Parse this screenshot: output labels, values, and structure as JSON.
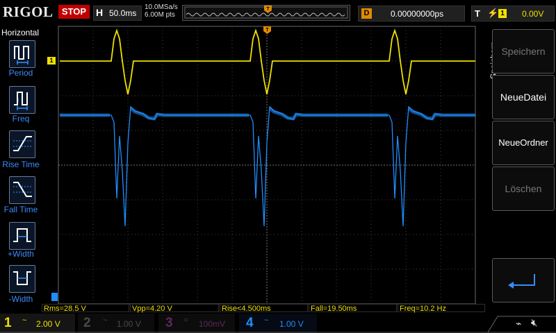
{
  "brand": "RIGOL",
  "run_state": "STOP",
  "horizontal": {
    "letter": "H",
    "timebase": "50.0ms",
    "sample_rate": "10.0MSa/s",
    "memory_depth": "6.00M pts"
  },
  "delay": {
    "letter": "D",
    "value": "0.00000000ps"
  },
  "trigger": {
    "letter": "T",
    "edge_icon": "rising-edge-icon",
    "source": "1",
    "level": "0.00V"
  },
  "left_menu": {
    "title": "Horizontal",
    "items": [
      {
        "label": "Period",
        "icon": "period-icon"
      },
      {
        "label": "Freq",
        "icon": "freq-icon"
      },
      {
        "label": "Rise Time",
        "icon": "rise-time-icon"
      },
      {
        "label": "Fall Time",
        "icon": "fall-time-icon"
      },
      {
        "label": "+Width",
        "icon": "plus-width-icon"
      },
      {
        "label": "-Width",
        "icon": "minus-width-icon"
      }
    ]
  },
  "right_menu": {
    "title": "Speichern",
    "items": [
      {
        "label": "Speichern",
        "enabled": false
      },
      {
        "label": "NeueDatei",
        "enabled": true
      },
      {
        "label": "NeueOrdner",
        "enabled": true
      },
      {
        "label": "Löschen",
        "enabled": false
      },
      {
        "label": "",
        "icon": "enter-arrow-icon",
        "enabled": true
      }
    ]
  },
  "ch1_marker": "1",
  "measurements": [
    {
      "label": "Rms=28.5 V"
    },
    {
      "label": "Vpp=4.20 V"
    },
    {
      "label": "Rise<4.500ms"
    },
    {
      "label": "Fall=19.50ms"
    },
    {
      "label": "Freq=10.2 Hz"
    }
  ],
  "channels": [
    {
      "num": "1",
      "coupling": "~",
      "scale": "2.00 V",
      "color": "#f0e000",
      "active": true
    },
    {
      "num": "2",
      "coupling": "~",
      "scale": "1.00 V",
      "color": "#4a4a4a",
      "active": false
    },
    {
      "num": "3",
      "coupling": "=",
      "scale": "100mV",
      "color": "#5a2a5a",
      "active": false
    },
    {
      "num": "4",
      "coupling": "~",
      "scale": "1.00 V",
      "color": "#1f8fff",
      "active": true
    }
  ],
  "colors": {
    "ch1": "#f0e000",
    "ch4": "#1f8fff",
    "accent_orange": "#e08a00",
    "stop_red": "#c00000"
  }
}
